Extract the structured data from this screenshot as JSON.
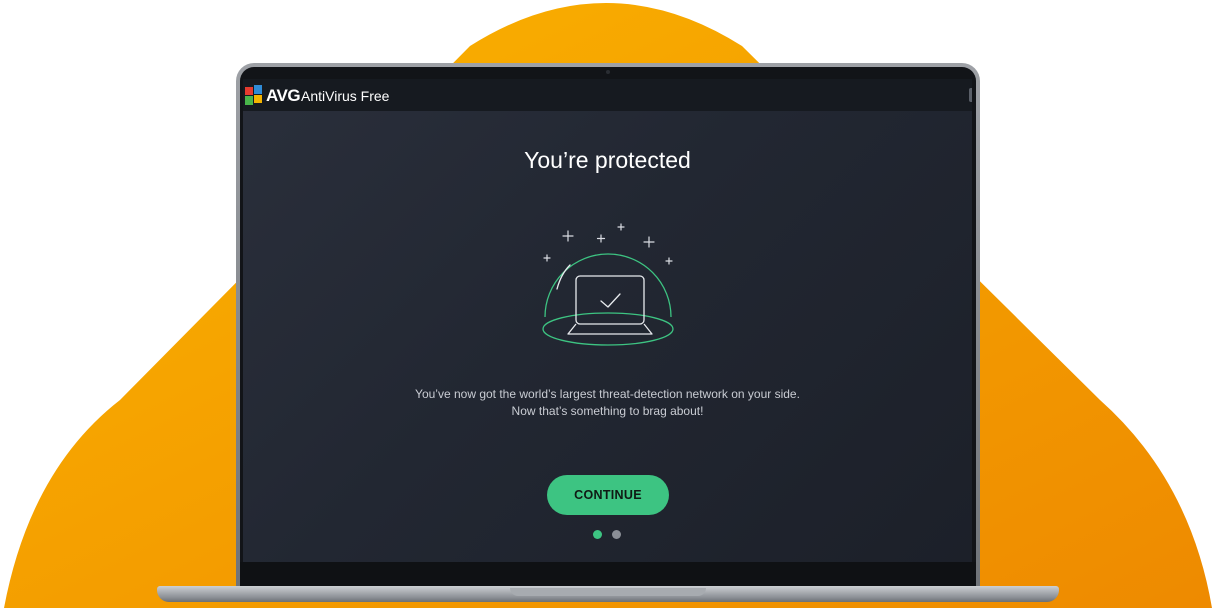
{
  "app": {
    "brand": "AVG",
    "product": "AntiVirus Free"
  },
  "onboarding": {
    "headline": "You’re protected",
    "description_line1": "You’ve now got the world’s largest threat-detection network on your side.",
    "description_line2": "Now that’s something to brag about!",
    "continue_label": "CONTINUE",
    "page_indicator": {
      "current": 1,
      "total": 2
    }
  },
  "icons": {
    "logo": "avg-logo-icon",
    "illustration": "protected-laptop-dome-icon"
  },
  "colors": {
    "accent": "#3dc482",
    "background_shape": "#f7a400",
    "screen_bg": "#252a35",
    "titlebar_bg": "#161a20"
  }
}
